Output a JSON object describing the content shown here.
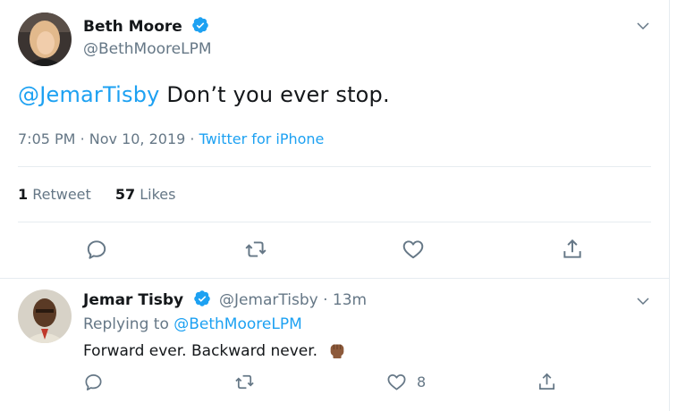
{
  "main_tweet": {
    "author_name": "Beth Moore",
    "author_handle": "@BethMooreLPM",
    "mention": "@JemarTisby",
    "text": " Don’t you ever stop.",
    "time": "7:05 PM",
    "sep1": "·",
    "date": "Nov 10, 2019",
    "sep2": "·",
    "source": "Twitter for iPhone",
    "retweet_count": "1",
    "retweet_label": "Retweet",
    "like_count": "57",
    "like_label": "Likes"
  },
  "reply": {
    "author_name": "Jemar Tisby",
    "author_handle": "@JemarTisby",
    "sep": "·",
    "age": "13m",
    "replying_to_label": "Replying to",
    "replying_to_handle": "@BethMooreLPM",
    "text": "Forward ever. Backward never.",
    "like_count": "8"
  },
  "icons": [
    "verified-badge-icon",
    "chevron-down-icon",
    "reply-icon",
    "retweet-icon",
    "like-icon",
    "share-icon",
    "raised-fist-emoji"
  ],
  "colors": {
    "accent": "#1da1f2",
    "muted": "#657786",
    "text": "#14171a",
    "border": "#e6ecf0"
  }
}
